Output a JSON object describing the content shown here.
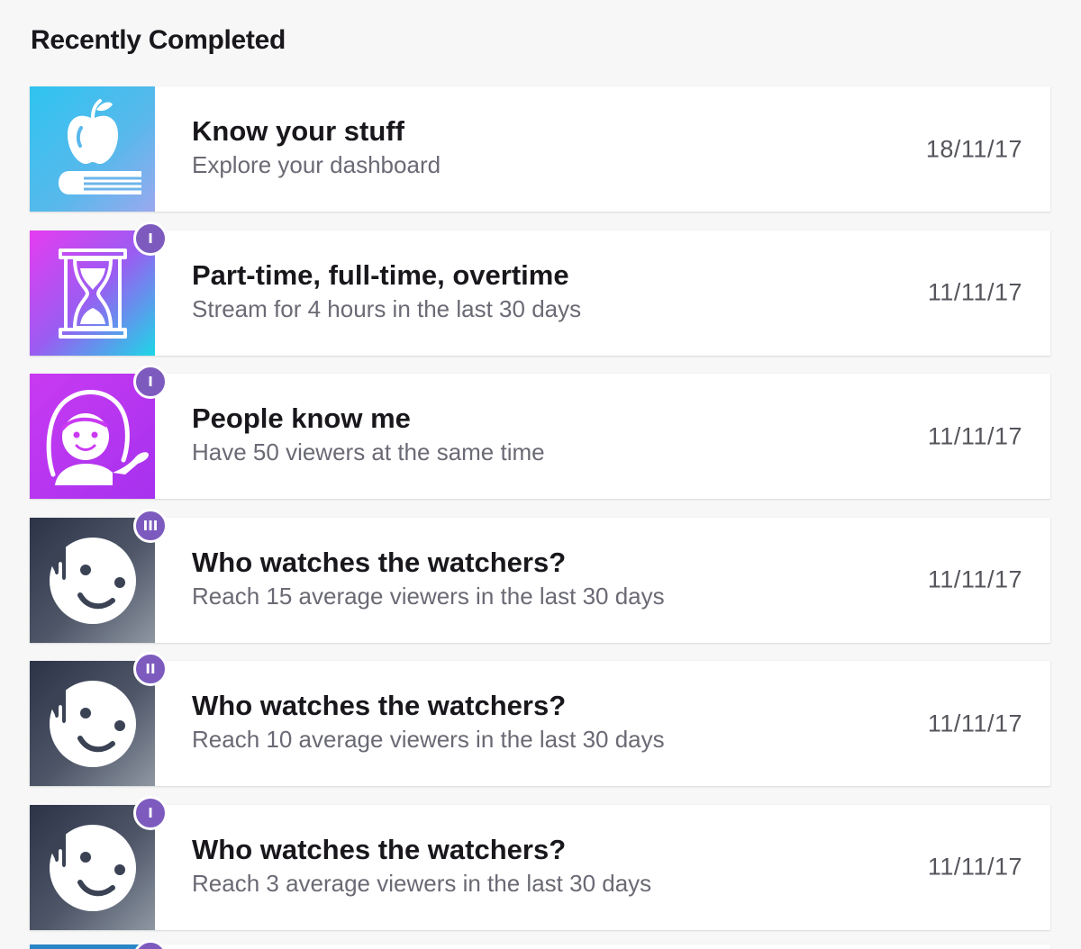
{
  "section_title": "Recently Completed",
  "colors": {
    "tier_badge": "#7d5bbe",
    "title_text": "#19171c",
    "description_text": "#6a6a75",
    "date_text": "#55555c"
  },
  "achievements": [
    {
      "icon": "apple-book-icon",
      "tier": "",
      "title": "Know your stuff",
      "description": "Explore your dashboard",
      "date": "18/11/17"
    },
    {
      "icon": "hourglass-icon",
      "tier": "I",
      "title": "Part-time, full-time, overtime",
      "description": "Stream for 4 hours in the last 30 days",
      "date": "11/11/17"
    },
    {
      "icon": "person-presenting-icon",
      "tier": "I",
      "title": "People know me",
      "description": "Have 50 viewers at the same time",
      "date": "11/11/17"
    },
    {
      "icon": "winking-face-icon",
      "tier": "III",
      "title": "Who watches the watchers?",
      "description": "Reach 15 average viewers in the last 30 days",
      "date": "11/11/17"
    },
    {
      "icon": "winking-face-icon",
      "tier": "II",
      "title": "Who watches the watchers?",
      "description": "Reach 10 average viewers in the last 30 days",
      "date": "11/11/17"
    },
    {
      "icon": "winking-face-icon",
      "tier": "I",
      "title": "Who watches the watchers?",
      "description": "Reach 3 average viewers in the last 30 days",
      "date": "11/11/17"
    }
  ]
}
